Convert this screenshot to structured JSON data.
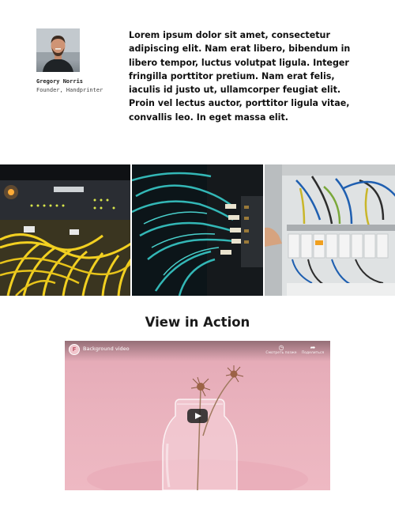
{
  "testimonial": {
    "quote": "Lorem ipsum dolor sit amet, consectetur adipiscing elit. Nam erat libero, bibendum in libero tempor, luctus volutpat ligula. Integer fringilla porttitor pretium. Nam erat felis, iaculis id justo ut, ullamcorper feugiat elit. Proin vel lectus auctor, porttitor ligula vitae, convallis leo. In eget massa elit.",
    "author_name": "Gregory Norris",
    "author_role": "Founder, Handprinter"
  },
  "gallery": {
    "photos": [
      {
        "icon": "server-rack-cables-photo"
      },
      {
        "icon": "fiber-optic-cables-photo"
      },
      {
        "icon": "electrical-panel-photo"
      }
    ]
  },
  "video_section": {
    "title": "View in Action",
    "video": {
      "title": "Background video",
      "channel_logo": "F",
      "actions": [
        {
          "icon": "watch-later-icon",
          "label": "Смотреть позже"
        },
        {
          "icon": "share-icon",
          "label": "Поделиться"
        }
      ]
    }
  },
  "colors": {
    "text": "#111111",
    "video_background": "#eab3be",
    "play_button": "#212121"
  }
}
